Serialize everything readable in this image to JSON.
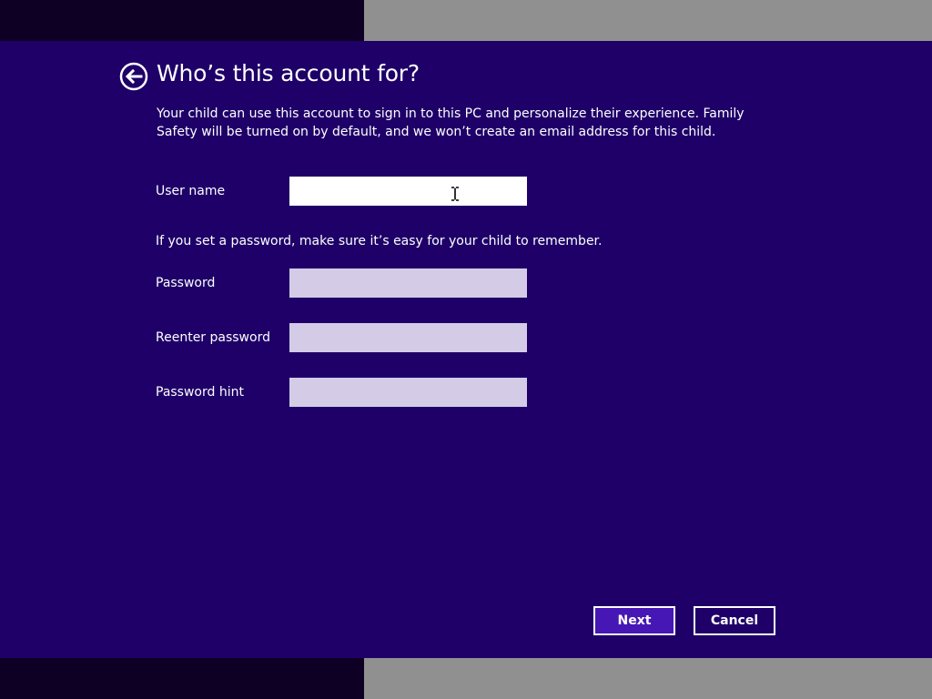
{
  "header": {
    "title": "Who’s this account for?",
    "back_icon": "back-arrow-circle-icon"
  },
  "description": "Your child can use this account to sign in to this PC and personalize their experience. Family Safety will be turned on by default, and we won’t create an email address for this child.",
  "form": {
    "username": {
      "label": "User name",
      "value": ""
    },
    "password_hint_text": "If you set a password, make sure it’s easy for your child to remember.",
    "password": {
      "label": "Password",
      "value": ""
    },
    "reenter_password": {
      "label": "Reenter password",
      "value": ""
    },
    "password_hint": {
      "label": "Password hint",
      "value": ""
    }
  },
  "buttons": {
    "next": "Next",
    "cancel": "Cancel"
  },
  "colors": {
    "background": "#1e0068",
    "next_button": "#4617b4",
    "input_inactive": "#d4cbe6",
    "input_active": "#ffffff"
  }
}
